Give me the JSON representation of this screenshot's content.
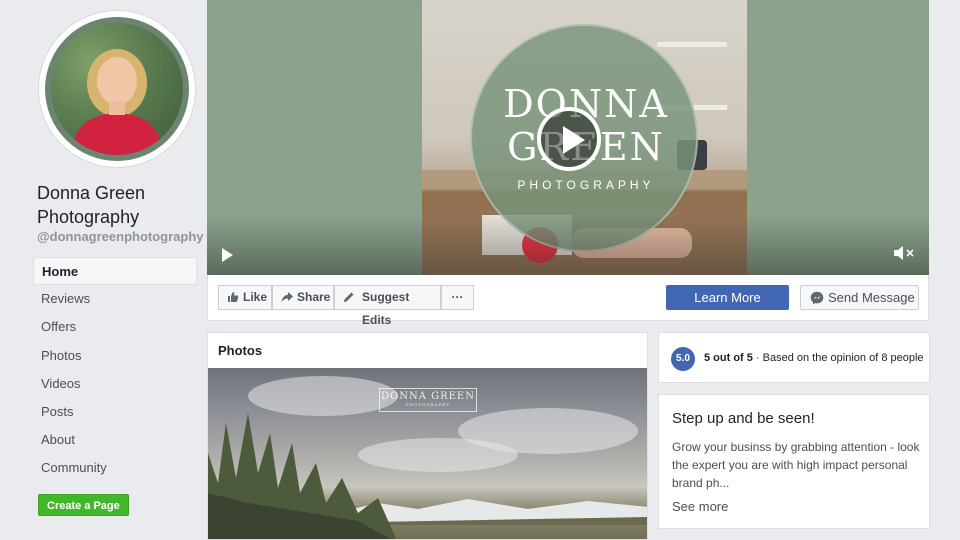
{
  "page": {
    "name": "Donna Green Photography",
    "handle": "@donnagreenphotography"
  },
  "nav": {
    "items": [
      {
        "label": "Home"
      },
      {
        "label": "Reviews"
      },
      {
        "label": "Offers"
      },
      {
        "label": "Photos"
      },
      {
        "label": "Videos"
      },
      {
        "label": "Posts"
      },
      {
        "label": "About"
      },
      {
        "label": "Community"
      }
    ],
    "active": "Home"
  },
  "create_page_label": "Create a Page",
  "cover": {
    "logo_line1": "DONNA",
    "logo_line2": "GREEN",
    "logo_sub": "PHOTOGRAPHY",
    "bg_color": "#8ba38d"
  },
  "actions": {
    "like": "Like",
    "share": "Share",
    "suggest": "Suggest Edits",
    "more": "···",
    "learn_more": "Learn More",
    "send_message": "Send Message"
  },
  "photos": {
    "title": "Photos",
    "watermark": "DONNA GREEN",
    "watermark_sub": "PHOTOGRAPHY"
  },
  "rating": {
    "score": "5.0",
    "summary": "5 out of 5",
    "detail": "· Based on the opinion of 8 people"
  },
  "promo": {
    "title": "Step up and be seen!",
    "body": "Grow your businss by grabbing attention - look the expert you are with high impact personal brand ph...",
    "see_more": "See more"
  },
  "colors": {
    "accent": "#4267b2",
    "create_green": "#42b72a",
    "cover_green": "#8ba38d"
  }
}
